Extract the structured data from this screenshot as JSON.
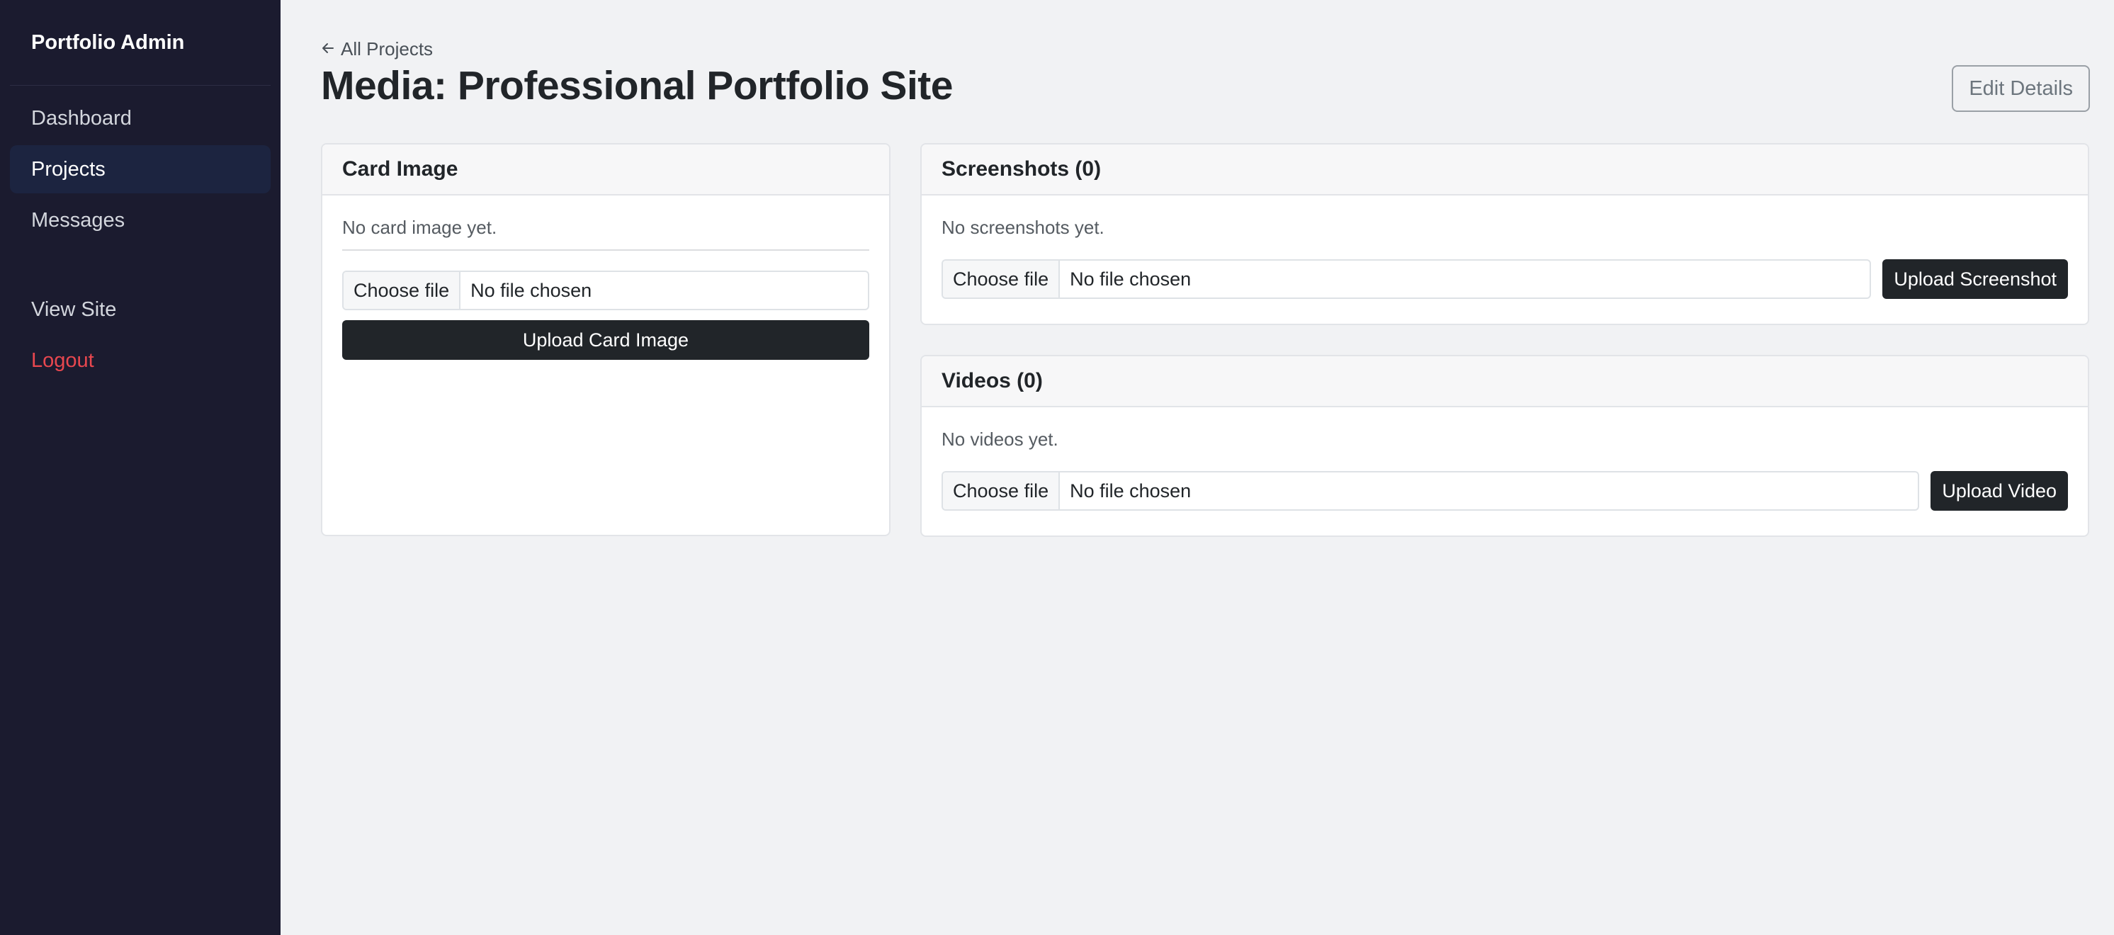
{
  "sidebar": {
    "brand": "Portfolio Admin",
    "items": [
      {
        "label": "Dashboard"
      },
      {
        "label": "Projects"
      },
      {
        "label": "Messages"
      },
      {
        "label": "View Site"
      },
      {
        "label": "Logout"
      }
    ],
    "active_item": "Projects"
  },
  "header": {
    "back_link": "All Projects",
    "title": "Media: Professional Portfolio Site",
    "edit_button": "Edit Details"
  },
  "card_image": {
    "title": "Card Image",
    "empty_text": "No card image yet.",
    "choose_file": "Choose file",
    "file_status": "No file chosen",
    "upload_button": "Upload Card Image"
  },
  "screenshots": {
    "title": "Screenshots (0)",
    "empty_text": "No screenshots yet.",
    "choose_file": "Choose file",
    "file_status": "No file chosen",
    "upload_button": "Upload Screenshot"
  },
  "videos": {
    "title": "Videos (0)",
    "empty_text": "No videos yet.",
    "choose_file": "Choose file",
    "file_status": "No file chosen",
    "upload_button": "Upload Video"
  },
  "colors": {
    "sidebar_bg": "#1b1b2f",
    "active_item_bg": "#1c2440",
    "logout": "#e8474f",
    "button_dark": "#212529",
    "page_bg": "#f1f2f4"
  },
  "icons": {
    "back": "arrow-left-icon"
  }
}
